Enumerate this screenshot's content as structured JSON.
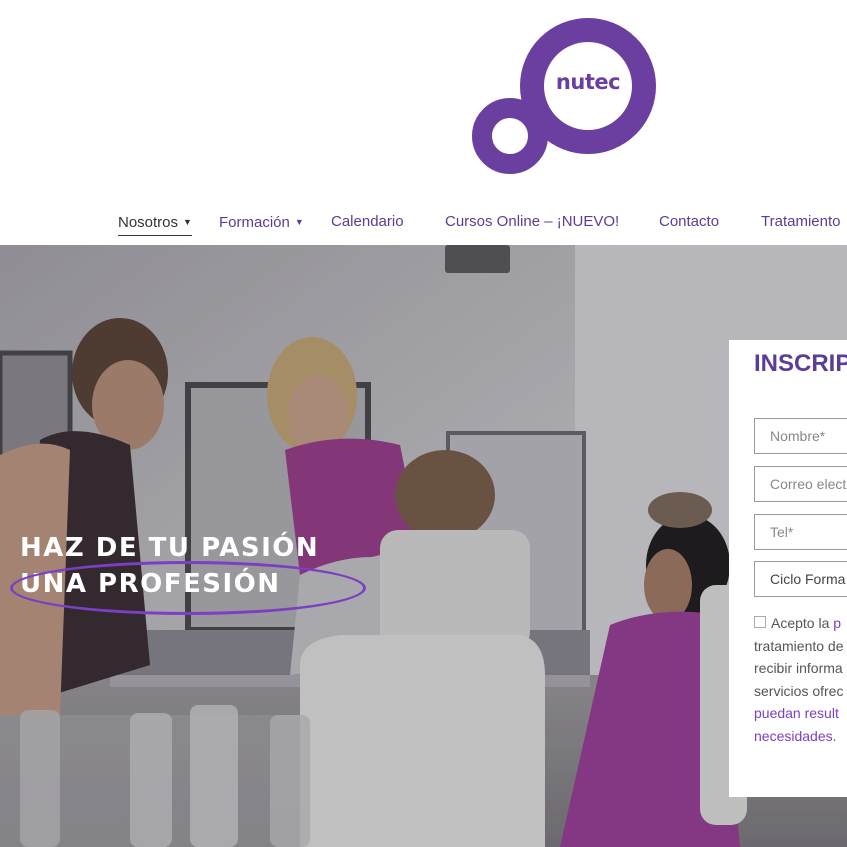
{
  "brand": {
    "name": "nutec",
    "color": "#6b3fa0"
  },
  "nav": {
    "items": [
      {
        "label": "Nosotros",
        "has_dropdown": true,
        "active": true
      },
      {
        "label": "Formación",
        "has_dropdown": true,
        "active": false
      },
      {
        "label": "Calendario",
        "has_dropdown": false,
        "active": false
      },
      {
        "label": "Cursos Online – ¡NUEVO!",
        "has_dropdown": false,
        "active": false
      },
      {
        "label": "Contacto",
        "has_dropdown": false,
        "active": false
      },
      {
        "label": "Tratamiento",
        "has_dropdown": false,
        "active": false
      }
    ],
    "dropdown_icon": "caret-down-icon"
  },
  "hero": {
    "headline_line1": "HAZ DE TU PASIÓN",
    "headline_line2": "UNA PROFESIÓN",
    "accent_color": "#7b3fc2"
  },
  "form": {
    "title": "INSCRIP",
    "fields": {
      "name_placeholder": "Nombre*",
      "email_placeholder": "Correo elect",
      "phone_placeholder": "Tel*",
      "cycle_select_value": "Ciclo Forma"
    },
    "consent": {
      "prefix": "Acepto la ",
      "link": "p",
      "line2": "tratamiento de",
      "line3": "recibir informa",
      "line4": "servicios ofrec",
      "line5": "puedan result",
      "line6": "necesidades."
    }
  }
}
